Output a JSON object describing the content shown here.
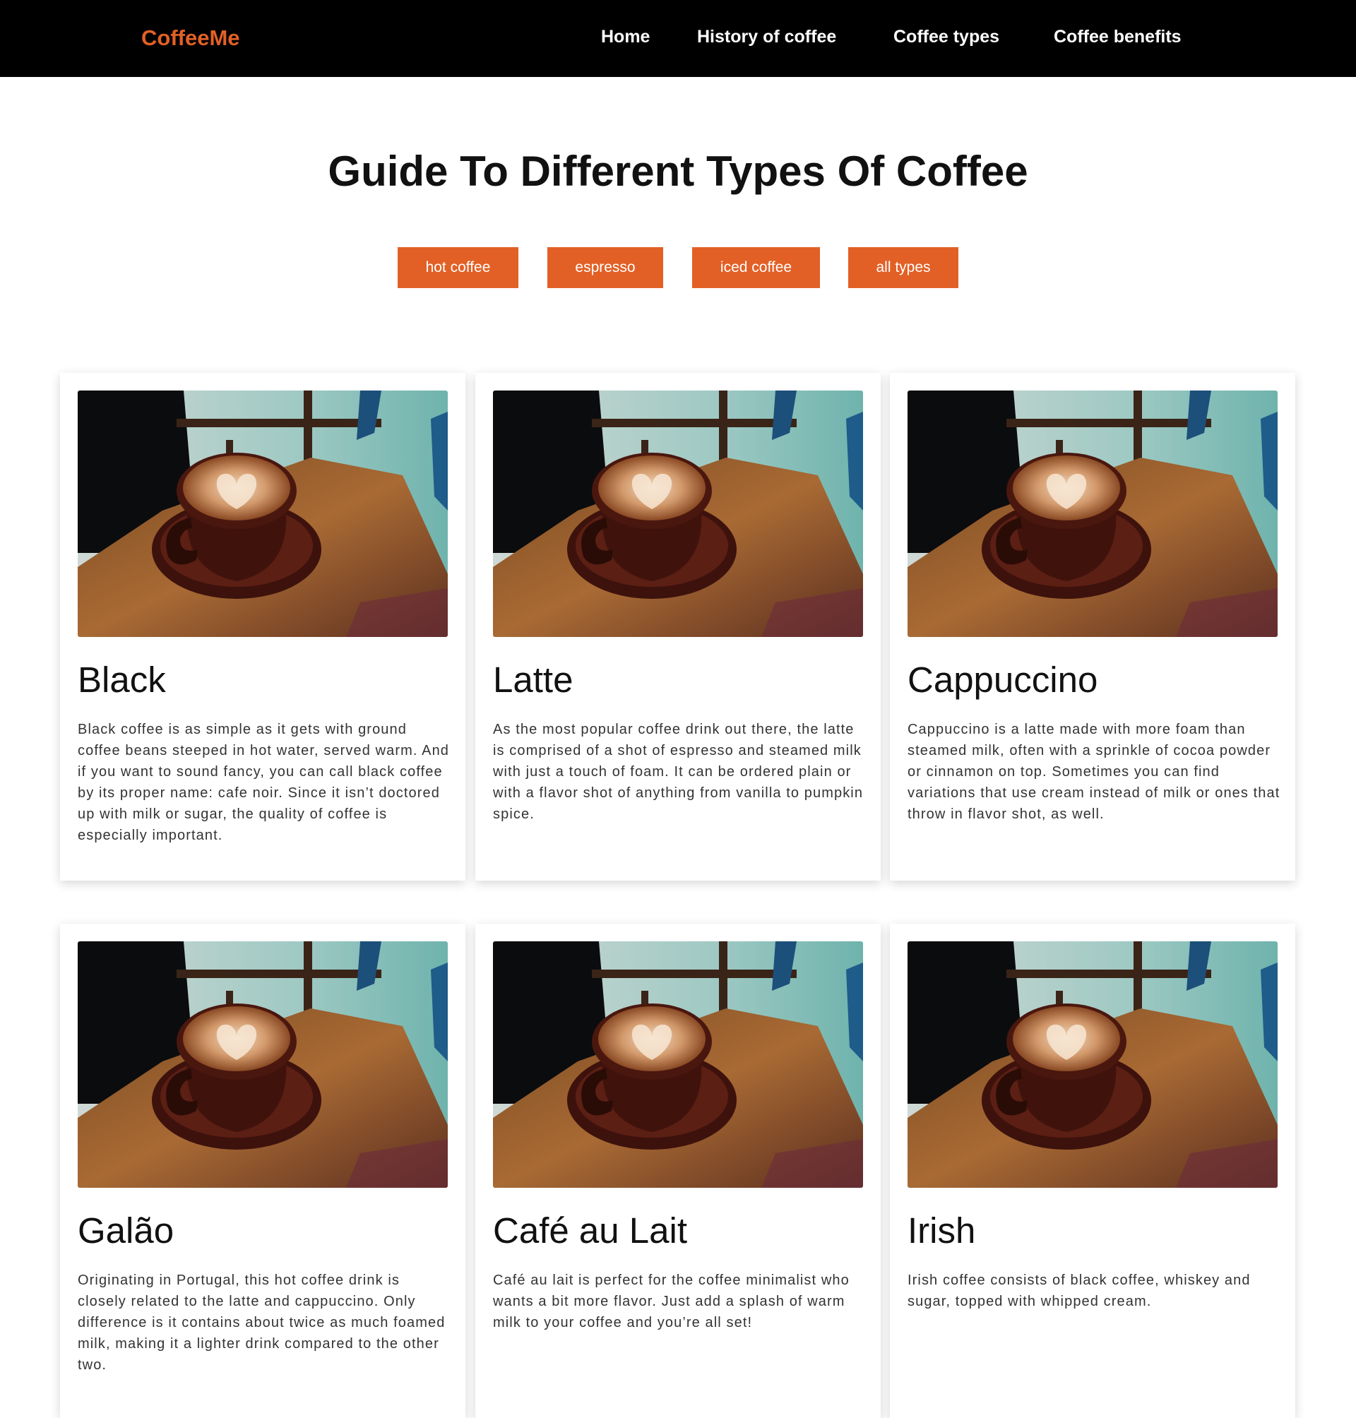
{
  "brand": "CoffeeMe",
  "nav": {
    "items": [
      "Home",
      "History of coffee",
      "Coffee types",
      "Coffee benefits"
    ]
  },
  "page_title": "Guide To Different Types Of Coffee",
  "filters": [
    "hot coffee",
    "espresso",
    "iced coffee",
    "all types"
  ],
  "colors": {
    "accent": "#e26026",
    "nav_bg": "#000000"
  },
  "cards": [
    {
      "title": "Black",
      "text": "Black coffee is as simple as it gets with ground coffee beans steeped in hot water, served warm. And if you want to sound fancy, you can call black coffee by its proper name: cafe noir. Since it isn’t doctored up with milk or sugar, the quality of coffee is especially important."
    },
    {
      "title": "Latte",
      "text": "As the most popular coffee drink out there, the latte is comprised of a shot of espresso and steamed milk with just a touch of foam. It can be ordered plain or with a flavor shot of anything from vanilla to pumpkin spice."
    },
    {
      "title": "Cappuccino",
      "text": "Cappuccino is a latte made with more foam than steamed milk, often with a sprinkle of cocoa powder or cinnamon on top. Sometimes you can find variations that use cream instead of milk or ones that throw in flavor shot, as well."
    },
    {
      "title": "Galão",
      "text": "Originating in Portugal, this hot coffee drink is closely related to the latte and cappuccino. Only difference is it contains about twice as much foamed milk, making it a lighter drink compared to the other two."
    },
    {
      "title": "Café au Lait",
      "text": "Café au lait is perfect for the coffee minimalist who wants a bit more flavor. Just add a splash of warm milk to your coffee and you’re all set!"
    },
    {
      "title": "Irish",
      "text": "Irish coffee consists of black coffee, whiskey and sugar, topped with whipped cream."
    }
  ]
}
